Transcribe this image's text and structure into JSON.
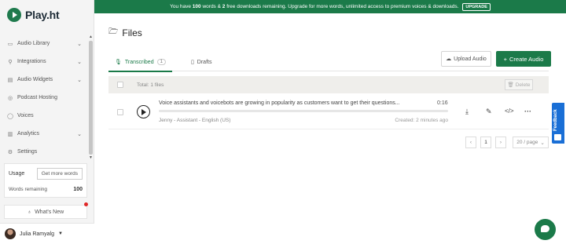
{
  "brand": {
    "name": "Play.ht"
  },
  "banner": {
    "prefix": "You have",
    "words": "100",
    "mid": "words &",
    "downloads": "2",
    "suffix": "free downloads remaining. Upgrade for more words, unlimited access to premium voices & downloads.",
    "upgrade_label": "UPGRADE"
  },
  "sidebar": {
    "items": [
      {
        "label": "Audio Library",
        "icon": "folder-icon",
        "has_chevron": true
      },
      {
        "label": "Integrations",
        "icon": "plug-icon",
        "has_chevron": true
      },
      {
        "label": "Audio Widgets",
        "icon": "widget-icon",
        "has_chevron": true
      },
      {
        "label": "Podcast Hosting",
        "icon": "podcast-icon",
        "has_chevron": false
      },
      {
        "label": "Voices",
        "icon": "voice-icon",
        "has_chevron": false
      },
      {
        "label": "Analytics",
        "icon": "chart-icon",
        "has_chevron": true
      },
      {
        "label": "Settings",
        "icon": "gear-icon",
        "has_chevron": false
      }
    ],
    "usage": {
      "label": "Usage",
      "get_more": "Get more words",
      "words_label": "Words remaining",
      "words_value": "100"
    },
    "whats_new": "What's New",
    "user_name": "Julia Ramyalg"
  },
  "page": {
    "title": "Files",
    "tabs": [
      {
        "label": "Transcribed",
        "count": "1"
      },
      {
        "label": "Drafts"
      }
    ],
    "upload_label": "Upload Audio",
    "create_label": "Create Audio"
  },
  "table": {
    "total_label": "Total: 1 files",
    "delete_label": "Delete",
    "rows": [
      {
        "title": "Voice assistants and voicebots are growing in popularity as customers want to get their questions...",
        "duration": "0:16",
        "meta": "Jenny - Assistant - English (US)",
        "created": "Created: 2 minutes ago"
      }
    ]
  },
  "pagination": {
    "current_page": "1",
    "page_size": "20 / page"
  },
  "feedback_label": "Feedback",
  "colors": {
    "brand_green": "#1b7a49",
    "feedback_blue": "#1a6fd6"
  }
}
